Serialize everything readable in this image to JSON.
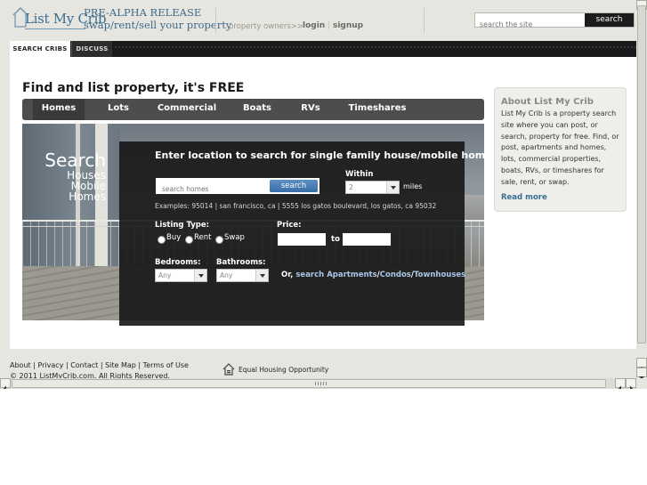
{
  "header": {
    "logo_text": "List My Crib",
    "release_line1": "PRE-ALPHA RELEASE",
    "release_line2": "swap/rent/sell your property",
    "owners_link": "property owners>>",
    "login": "login",
    "signup": "signup",
    "site_search_placeholder": "search the site",
    "site_search_button": "search"
  },
  "top_tabs": {
    "search": "SEARCH CRIBS",
    "discuss": "DISCUSS"
  },
  "tagline": "Find and list property, it's FREE",
  "categories": [
    "Homes",
    "Lots",
    "Commercial",
    "Boats",
    "RVs",
    "Timeshares"
  ],
  "hero": {
    "title": "Search",
    "line1": "Houses",
    "line2": "Mobile Homes"
  },
  "search_panel": {
    "title": "Enter location to search for single family house/mobile home",
    "placeholder": "search homes",
    "button": "search",
    "within_label": "Within",
    "within_value": "2",
    "miles": "miles",
    "examples": "Examples: 95014 | san francisco, ca | 5555 los gatos boulevard, los gatos, ca 95032",
    "listing_type_label": "Listing Type:",
    "listing_types": [
      "Buy",
      "Rent",
      "Swap"
    ],
    "price_label": "Price:",
    "price_to": "to",
    "bedrooms_label": "Bedrooms:",
    "bedrooms_value": "Any",
    "bathrooms_label": "Bathrooms:",
    "bathrooms_value": "Any",
    "or_text": "Or,",
    "or_search": "search",
    "or_links": [
      "Apartments",
      "Condos",
      "Townhouses"
    ]
  },
  "about": {
    "title": "About List My Crib",
    "body": "List My Crib is a property search site where you can post, or search, property for free. Find, or post, apartments and homes, lots, commercial properties, boats, RVs, or timeshares for sale, rent, or swap.",
    "more": "Read more"
  },
  "footer": {
    "links": [
      "About",
      "Privacy",
      "Contact",
      "Site Map",
      "Terms of Use"
    ],
    "copyright": "© 2011 ListMyCrib.com. All Rights Reserved.",
    "equal_housing": "Equal Housing Opportunity"
  },
  "colors": {
    "brand_blue": "#3a6f94",
    "link_blue": "#a9c6e8",
    "button_blue": "#3a6ea8"
  }
}
